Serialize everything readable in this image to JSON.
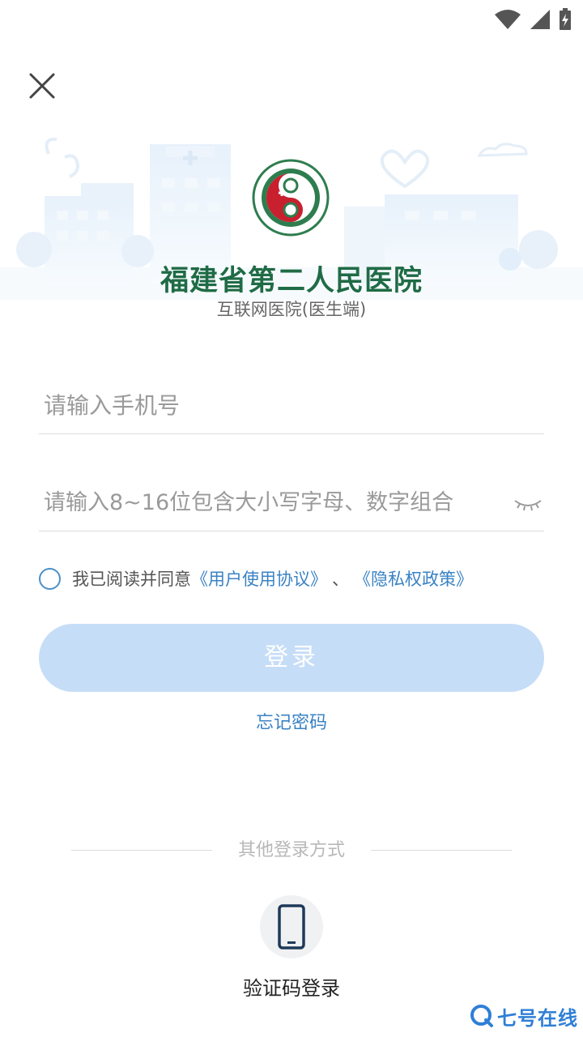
{
  "status_bar": {
    "icons": [
      "wifi-icon",
      "signal-icon",
      "battery-charging-icon"
    ]
  },
  "header": {
    "close_icon": "close-icon"
  },
  "hospital": {
    "logo_icon": "hospital-logo",
    "name": "福建省第二人民医院",
    "subtitle": "互联网医院(医生端)"
  },
  "form": {
    "phone_placeholder": "请输入手机号",
    "password_placeholder": "请输入8~16位包含大小写字母、数字组合",
    "password_toggle_icon": "eye-closed-icon"
  },
  "agreement": {
    "prefix": "我已阅读并同意",
    "user_agreement": "《用户使用协议》",
    "separator": "、",
    "privacy_policy": "《隐私权政策》",
    "checked": false
  },
  "actions": {
    "login_label": "登录",
    "forgot_password": "忘记密码"
  },
  "other_login": {
    "divider_text": "其他登录方式",
    "sms_icon": "mobile-phone-icon",
    "sms_label": "验证码登录"
  },
  "watermark": {
    "text": "七号在线"
  },
  "colors": {
    "brand_green": "#1f6b45",
    "link_blue": "#3a82c4",
    "login_disabled": "#c6ddf7",
    "logo_red": "#c8202e"
  }
}
